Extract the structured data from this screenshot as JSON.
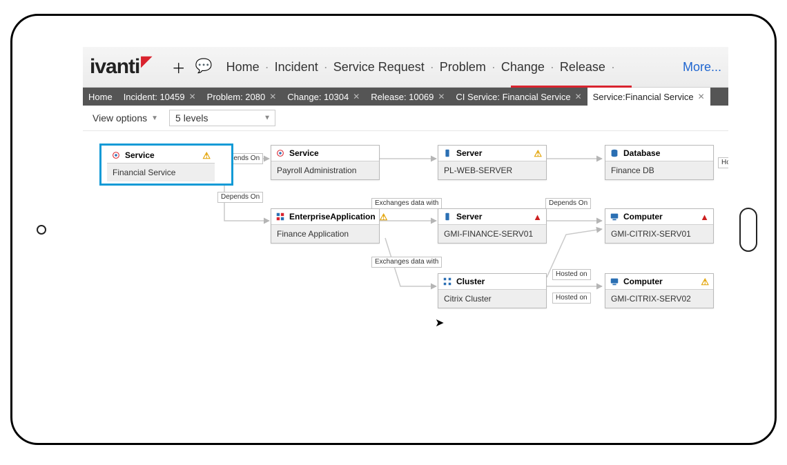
{
  "brand": {
    "name": "ivanti"
  },
  "topnav": {
    "items": [
      "Home",
      "Incident",
      "Service Request",
      "Problem",
      "Change",
      "Release"
    ],
    "more": "More..."
  },
  "tabs": [
    {
      "label": "Home",
      "closable": false,
      "active": false
    },
    {
      "label": "Incident: 10459",
      "closable": true,
      "active": false
    },
    {
      "label": "Problem: 2080",
      "closable": true,
      "active": false
    },
    {
      "label": "Change: 10304",
      "closable": true,
      "active": false
    },
    {
      "label": "Release: 10069",
      "closable": true,
      "active": false
    },
    {
      "label": "CI Service: Financial Service",
      "closable": true,
      "active": false
    },
    {
      "label": "Service:Financial Service",
      "closable": true,
      "active": true
    }
  ],
  "toolbar": {
    "view_options": "View options",
    "levels": "5 levels"
  },
  "rel_labels": {
    "depends_on": "Depends On",
    "exchanges": "Exchanges data with",
    "hosted_on": "Hosted on"
  },
  "nodes": {
    "svc_fin": {
      "type": "Service",
      "name": "Financial Service",
      "status": "warn"
    },
    "svc_pay": {
      "type": "Service",
      "name": "Payroll Administration",
      "status": ""
    },
    "srv_plweb": {
      "type": "Server",
      "name": "PL-WEB-SERVER",
      "status": "warn"
    },
    "db_fin": {
      "type": "Database",
      "name": "Finance DB",
      "status": ""
    },
    "ea_fin": {
      "type": "EnterpriseApplication",
      "name": "Finance Application",
      "status": "warn"
    },
    "srv_gmi": {
      "type": "Server",
      "name": "GMI-FINANCE-SERV01",
      "status": "crit"
    },
    "comp_c1": {
      "type": "Computer",
      "name": "GMI-CITRIX-SERV01",
      "status": "crit"
    },
    "cluster": {
      "type": "Cluster",
      "name": "Citrix Cluster",
      "status": ""
    },
    "comp_c2": {
      "type": "Computer",
      "name": "GMI-CITRIX-SERV02",
      "status": "warn"
    }
  },
  "edge_partial": "Ho"
}
